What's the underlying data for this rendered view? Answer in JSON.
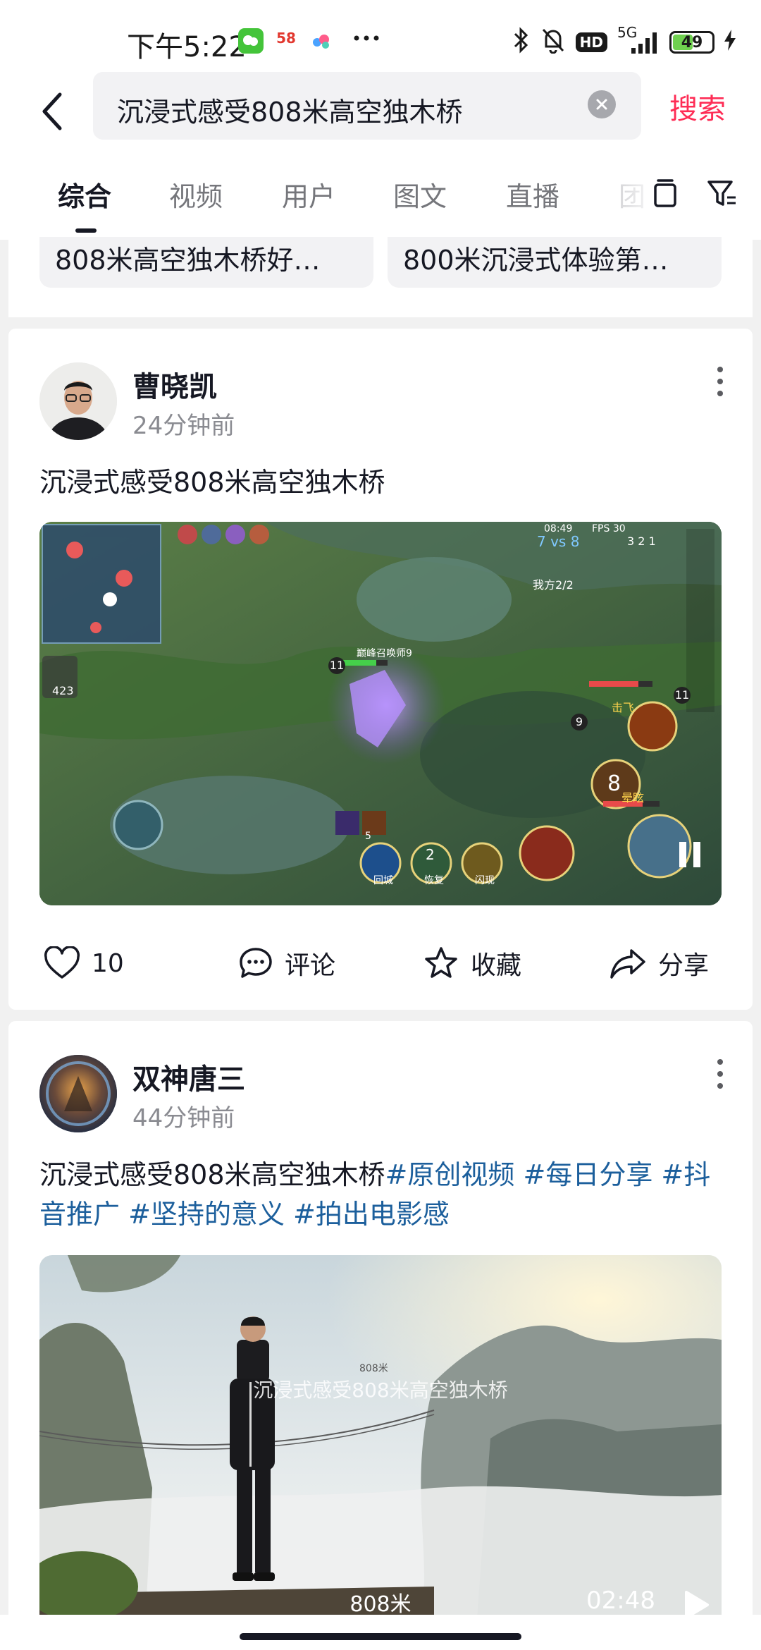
{
  "status_bar": {
    "time": "下午5:22",
    "network": "5G",
    "hd": "HD",
    "battery": "49",
    "app_badge": "58"
  },
  "search": {
    "query": "沉浸式感受808米高空独木桥",
    "submit_label": "搜索"
  },
  "tabs": [
    {
      "label": "综合",
      "active": true
    },
    {
      "label": "视频"
    },
    {
      "label": "用户"
    },
    {
      "label": "图文"
    },
    {
      "label": "直播"
    },
    {
      "label": "团"
    }
  ],
  "related": [
    {
      "label": "808米高空独木桥好…"
    },
    {
      "label": "800米沉浸式体验第…"
    }
  ],
  "posts": [
    {
      "author": "曹晓凯",
      "time": "24分钟前",
      "text": "沉浸式感受808米高空独木桥",
      "video": {
        "clock": "08:49",
        "score": "7 vs 8",
        "fps": "FPS 30",
        "gold": "423",
        "teammates": "我方2/2",
        "player_tag": "巅峰召唤师9",
        "skill_counter": "2",
        "skills": [
          "回城",
          "恢复",
          "闪现"
        ],
        "skill_count_small": "5",
        "enemy_level": "11",
        "player_level": "11",
        "ally_level": "9",
        "ally_center_level": "8",
        "hit_text": "击飞",
        "stun_text": "晕眩",
        "kda": "3  2  1"
      },
      "likes": "10",
      "comment_label": "评论",
      "favorite_label": "收藏",
      "share_label": "分享"
    },
    {
      "author": "双神唐三",
      "time": "44分钟前",
      "text_plain": "沉浸式感受808米高空独木桥",
      "hashtags": [
        "#原创视频",
        "#每日分享",
        "#抖音推广",
        "#坚持的意义",
        "#拍出电影感"
      ],
      "video": {
        "caption": "沉浸式感受808米高空独木桥",
        "small_text": "808米",
        "subtitle": "808米",
        "duration": "02:48"
      }
    }
  ],
  "colors": {
    "accent": "#fe2c55",
    "hashtag": "#1c5f9c",
    "text": "#161823",
    "muted": "#8a8b91"
  }
}
